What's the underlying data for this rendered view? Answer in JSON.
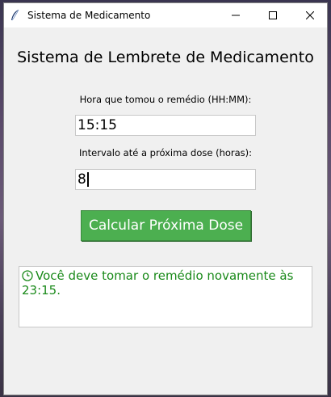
{
  "window": {
    "title": "Sistema de Medicamento"
  },
  "main": {
    "heading": "Sistema de Lembrete de Medicamento",
    "time_label": "Hora que tomou o remédio (HH:MM):",
    "time_value": "15:15",
    "interval_label": "Intervalo até a próxima dose (horas):",
    "interval_value": "8",
    "calc_button": "Calcular Próxima Dose",
    "result_text": "Você deve tomar o remédio novamente às 23:15."
  },
  "colors": {
    "button_bg": "#4caf50",
    "result_text": "#1a8a1a",
    "window_bg": "#f0f0f0"
  },
  "icons": {
    "app": "feather-icon",
    "result": "clock-icon"
  }
}
